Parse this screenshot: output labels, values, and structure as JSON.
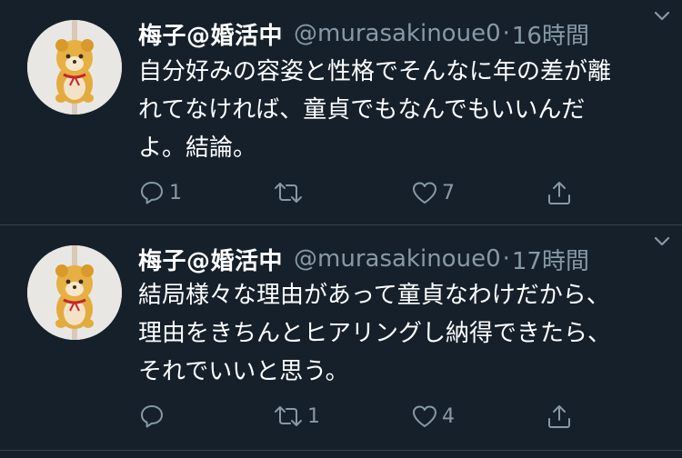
{
  "tweets": [
    {
      "name": "梅子@婚活中",
      "handle": "@murasakinoue0",
      "separator": "·",
      "time": "16時間",
      "text": "自分好みの容姿と性格でそんなに年の差が離\nれてなければ、童貞でもなんでもいいんだ\nよ。結論。",
      "reply_count": "1",
      "retweet_count": "",
      "like_count": "7",
      "icons": {
        "reply": "reply-icon",
        "retweet": "retweet-icon",
        "like": "heart-icon",
        "share": "share-icon",
        "menu": "chevron-down-icon"
      }
    },
    {
      "name": "梅子@婚活中",
      "handle": "@murasakinoue0",
      "separator": "·",
      "time": "17時間",
      "text": "結局様々な理由があって童貞なわけだから、\n理由をきちんとヒアリングし納得できたら、\nそれでいいと思う。",
      "reply_count": "",
      "retweet_count": "1",
      "like_count": "4",
      "icons": {
        "reply": "reply-icon",
        "retweet": "retweet-icon",
        "like": "heart-icon",
        "share": "share-icon",
        "menu": "chevron-down-icon"
      }
    }
  ],
  "colors": {
    "background": "#15202b",
    "divider": "#38444d",
    "secondary_text": "#8899a6",
    "primary_text": "#ffffff"
  }
}
